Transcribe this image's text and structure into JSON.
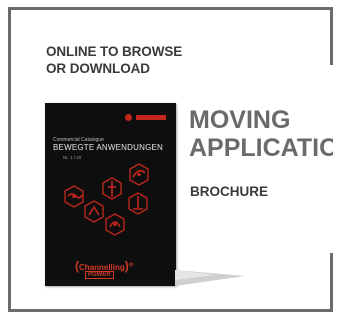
{
  "teaser": {
    "tag_line1": "ONLINE TO BROWSE",
    "tag_line2": "OR DOWNLOAD",
    "headline_line1": "MOVING",
    "headline_line2": "APPLICATIONS",
    "subtitle": "BROCHURE",
    "cover": {
      "kicker": "Commercial Catalogue",
      "title": "BEWEGTE ANWENDUNGEN",
      "sub": "Nr. 1 / 20",
      "badge_word": "Channelling",
      "badge_power": "POWER"
    }
  },
  "colors": {
    "border": "#6b6b6b",
    "headline": "#6a6a6a",
    "text": "#3a3a3a",
    "cover_bg": "#0e0e0e",
    "accent_red": "#c3271b"
  }
}
